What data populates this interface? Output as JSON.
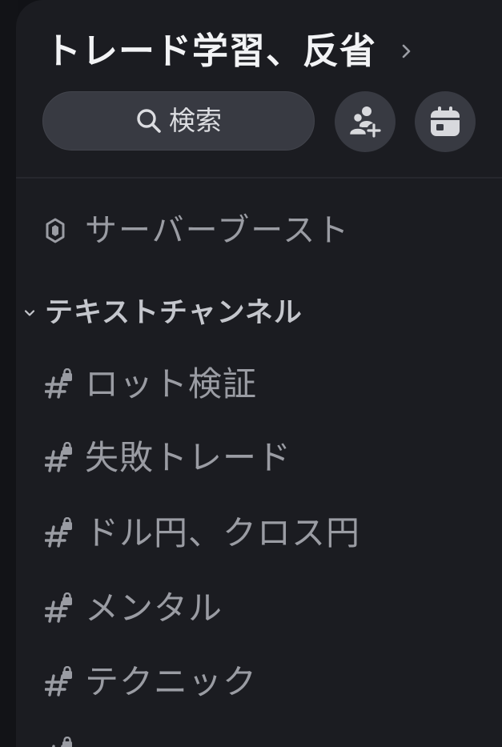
{
  "server": {
    "name": "トレード学習、反省"
  },
  "header": {
    "search_label": "検索"
  },
  "boost": {
    "label": "サーバーブースト"
  },
  "category": {
    "label": "テキストチャンネル"
  },
  "channels": [
    {
      "label": "ロット検証"
    },
    {
      "label": "失敗トレード"
    },
    {
      "label": "ドル円、クロス円"
    },
    {
      "label": "メンタル"
    },
    {
      "label": "テクニック"
    }
  ],
  "icons": {
    "title_chevron": "chevron-right-icon",
    "search": "search-icon",
    "invite": "add-member-icon",
    "events": "calendar-icon",
    "boost": "boost-gem-icon",
    "category": "chevron-down-icon",
    "channel": "locked-channel-hash-icon"
  },
  "colors": {
    "background": "#1b1c21",
    "button_bg": "#383a42",
    "title_text": "#f2f3f5",
    "muted_text": "#9a9ca3"
  }
}
